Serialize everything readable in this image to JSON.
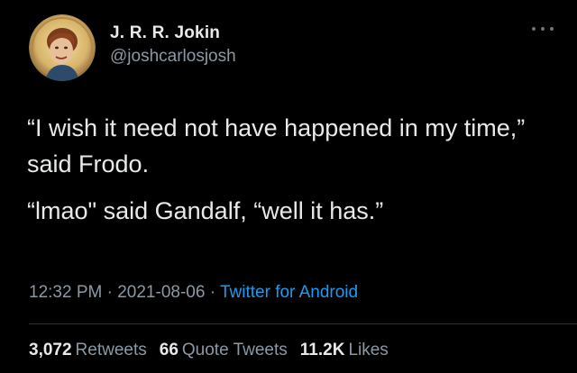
{
  "colors": {
    "background": "#000000",
    "primary_text": "#e7e9ea",
    "secondary_text": "#8b98a5",
    "link": "#1d9bf0",
    "divider": "#2f3336"
  },
  "author": {
    "display_name": "J. R. R. Jokin",
    "handle": "@joshcarlosjosh",
    "avatar_icon": "portrait-avatar"
  },
  "menu": {
    "icon": "more-options-icon"
  },
  "tweet": {
    "lines": [
      "“I wish it need not have happened in my time,” said Frodo.",
      "“lmao\" said Gandalf, “well it has.”"
    ]
  },
  "meta": {
    "time": "12:32 PM",
    "separator": "·",
    "date": "2021-08-06",
    "source": "Twitter for Android"
  },
  "stats": {
    "retweets_count": "3,072",
    "retweets_label": "Retweets",
    "quotes_count": "66",
    "quotes_label": "Quote Tweets",
    "likes_count": "11.2K",
    "likes_label": "Likes"
  }
}
